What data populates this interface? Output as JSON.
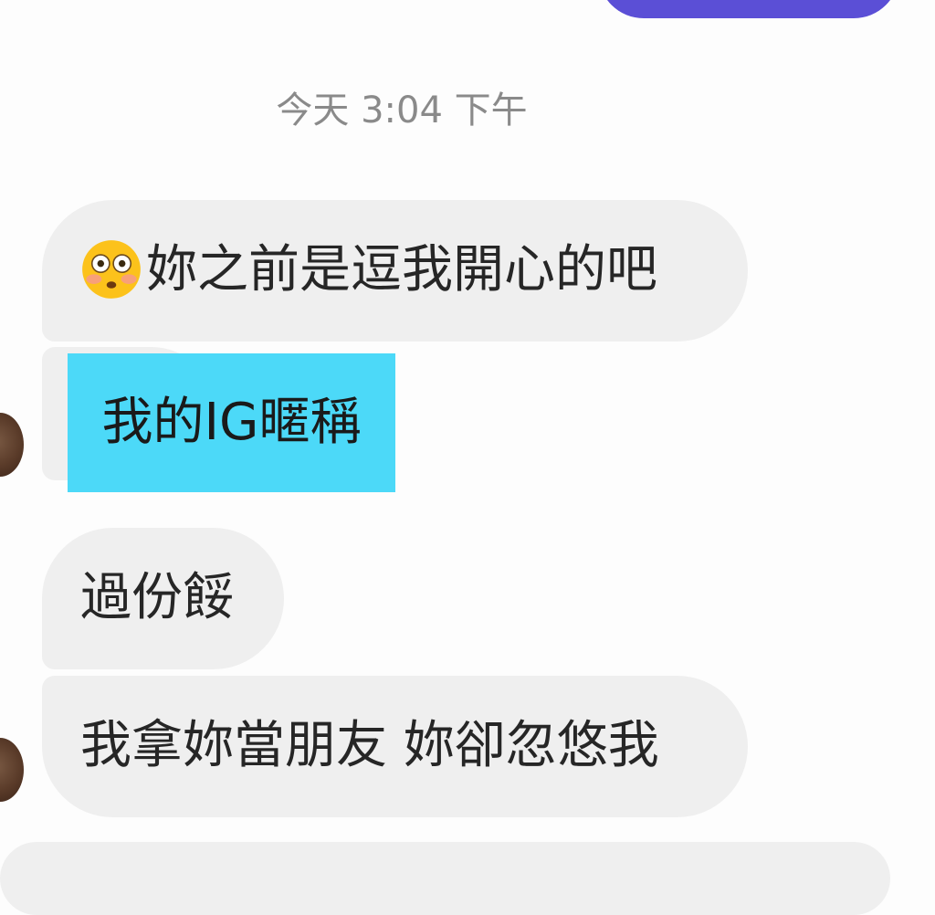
{
  "timestamp": "今天 3:04 下午",
  "messages": [
    {
      "emoji": "flushed-face-emoji",
      "text": "妳之前是逗我開心的吧"
    },
    {
      "label": "我的IG暱稱"
    },
    {
      "text": "過份餒"
    },
    {
      "text": "我拿妳當朋友 妳卻忽悠我"
    }
  ],
  "colors": {
    "sent_bubble": "#5b4fd6",
    "received_bubble": "#efefef",
    "redaction_label": "#4cd9f8",
    "timestamp_text": "#8a8a8a"
  }
}
